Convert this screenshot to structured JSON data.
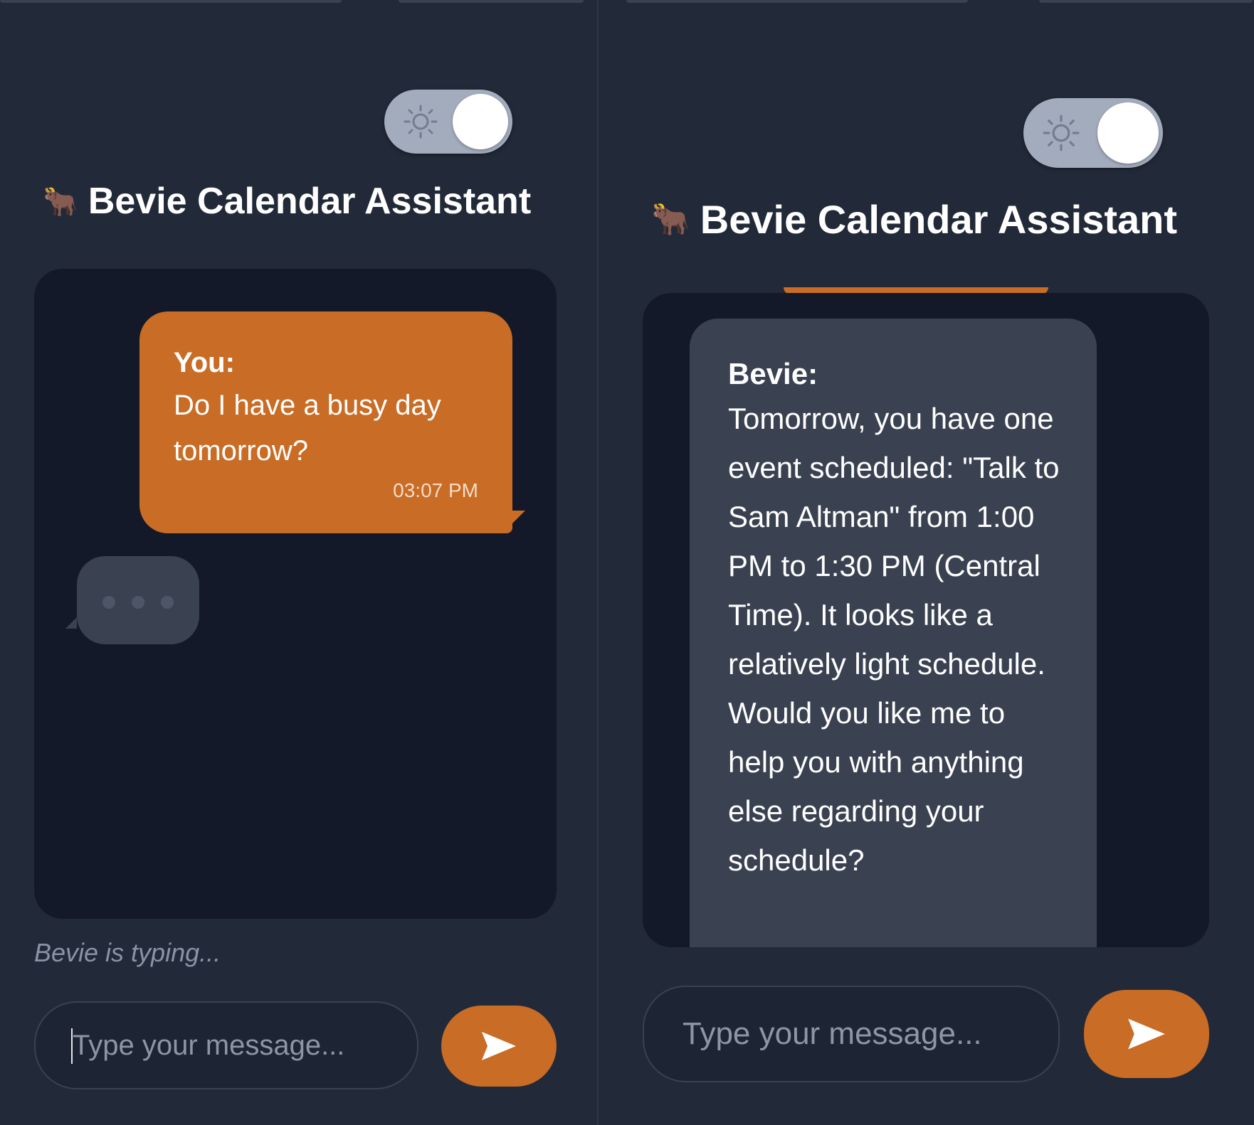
{
  "left_panel": {
    "title": "Bevie Calendar Assistant",
    "title_emoji": "🐂",
    "theme_toggle": {
      "icon": "sun-icon",
      "state": "dark"
    },
    "messages": [
      {
        "sender": "You:",
        "text": "Do I have a busy day tomorrow?",
        "time": "03:07 PM"
      }
    ],
    "typing_status": "Bevie is typing...",
    "input_placeholder": "Type your message...",
    "send_icon": "send-arrow-icon"
  },
  "right_panel": {
    "title": "Bevie Calendar Assistant",
    "title_emoji": "🐂",
    "theme_toggle": {
      "icon": "sun-icon",
      "state": "dark"
    },
    "messages": [
      {
        "sender": "Bevie:",
        "text": "Tomorrow, you have one event scheduled: \"Talk to Sam Altman\" from 1:00 PM to 1:30 PM (Central Time). It looks like a relatively light schedule. Would you like me to help you with anything else regarding your schedule?"
      }
    ],
    "input_placeholder": "Type your message...",
    "send_icon": "send-arrow-icon"
  },
  "colors": {
    "background": "#222938",
    "chat_background": "#131929",
    "accent": "#c96c25",
    "bot_bubble": "#3a4252",
    "toggle_track": "#a3acbd"
  }
}
